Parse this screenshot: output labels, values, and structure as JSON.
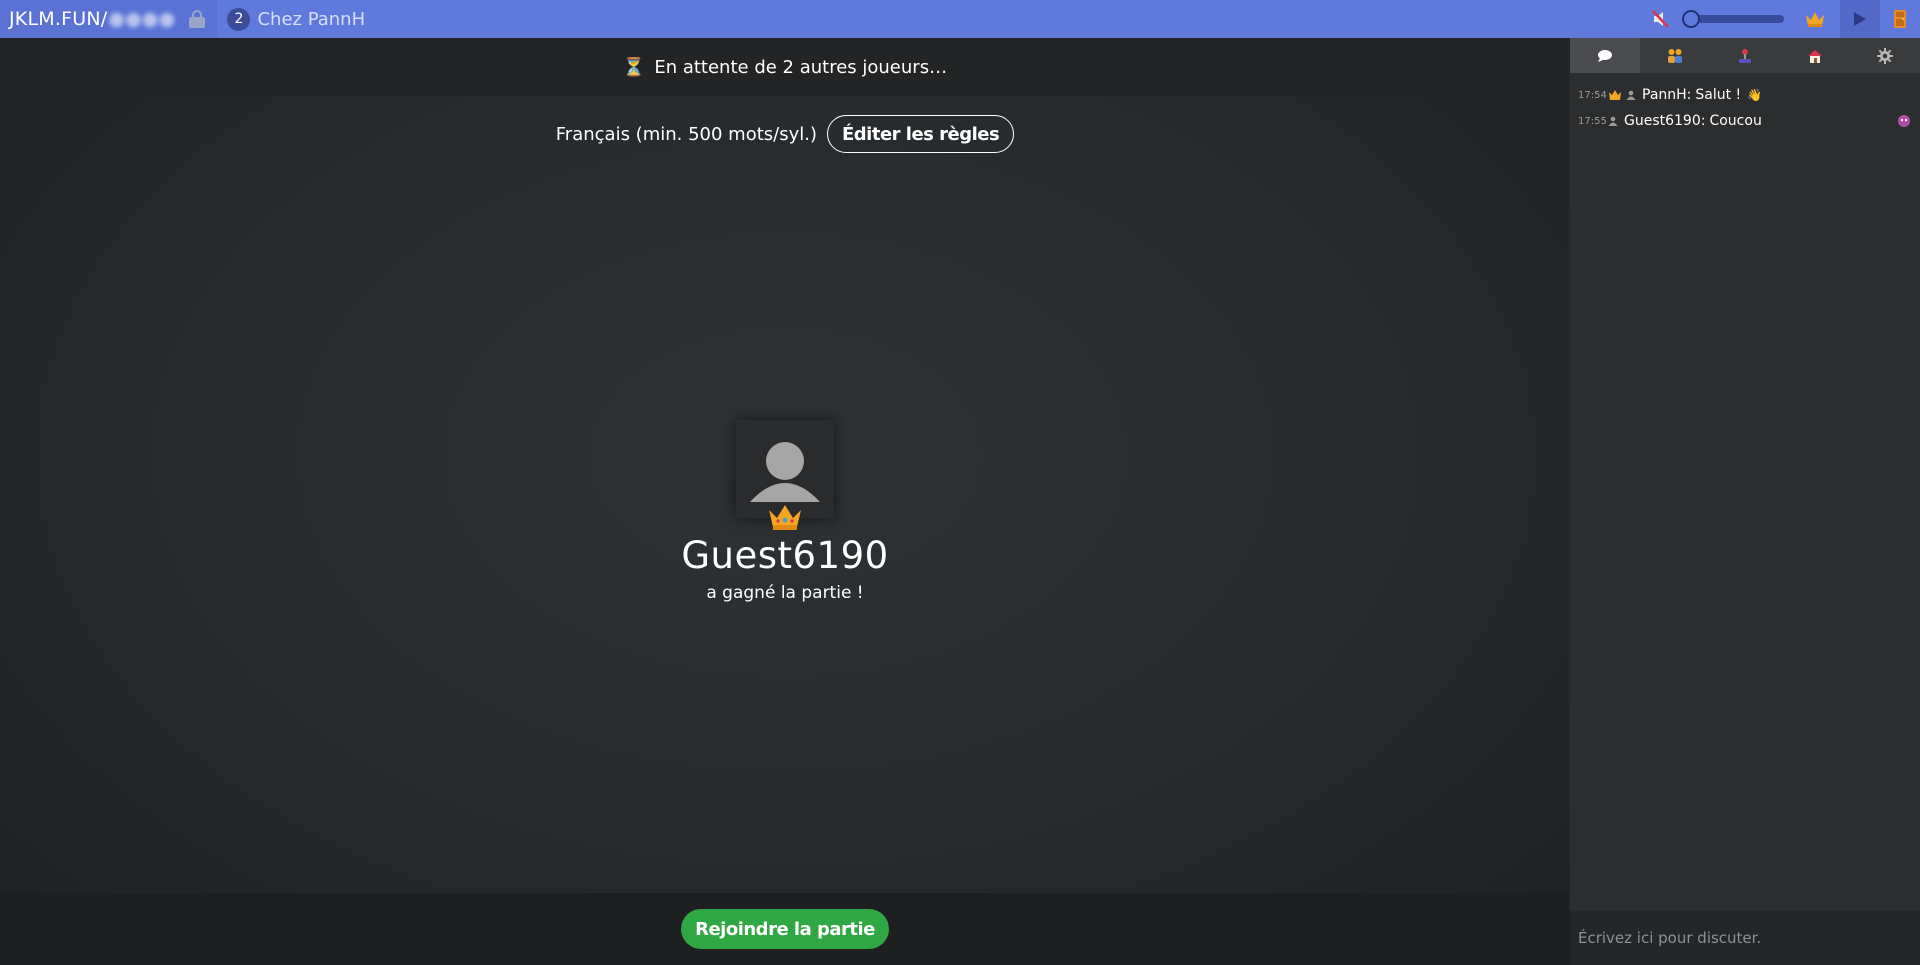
{
  "topbar": {
    "room_prefix": "JKLM.FUN/",
    "room_code_hidden": "●●●●",
    "player_count": "2",
    "room_name": "Chez PannH"
  },
  "game": {
    "status": "En attente de 2 autres joueurs…",
    "hourglass": "⏳",
    "rules_lang": "Français (min. 500 mots/syl.)",
    "edit_rules": "Éditer les règles",
    "winner_name": "Guest6190",
    "winner_text": "a gagné la partie !",
    "join_button": "Rejoindre la partie"
  },
  "sidebar": {
    "tabs": [
      "chat-icon",
      "players-icon",
      "joystick-icon",
      "house-icon",
      "gear-icon"
    ],
    "messages": [
      {
        "time": "17:54",
        "author": "PannH",
        "text": "Salut !",
        "emoji": "👋",
        "crown": true
      },
      {
        "time": "17:55",
        "author": "Guest6190",
        "text": "Coucou",
        "emoji": "",
        "crown": false
      }
    ],
    "chat_placeholder": "Écrivez ici pour discuter."
  },
  "colors": {
    "topbar": "#6079dd",
    "join": "#2fa843",
    "background": "#26292c"
  }
}
